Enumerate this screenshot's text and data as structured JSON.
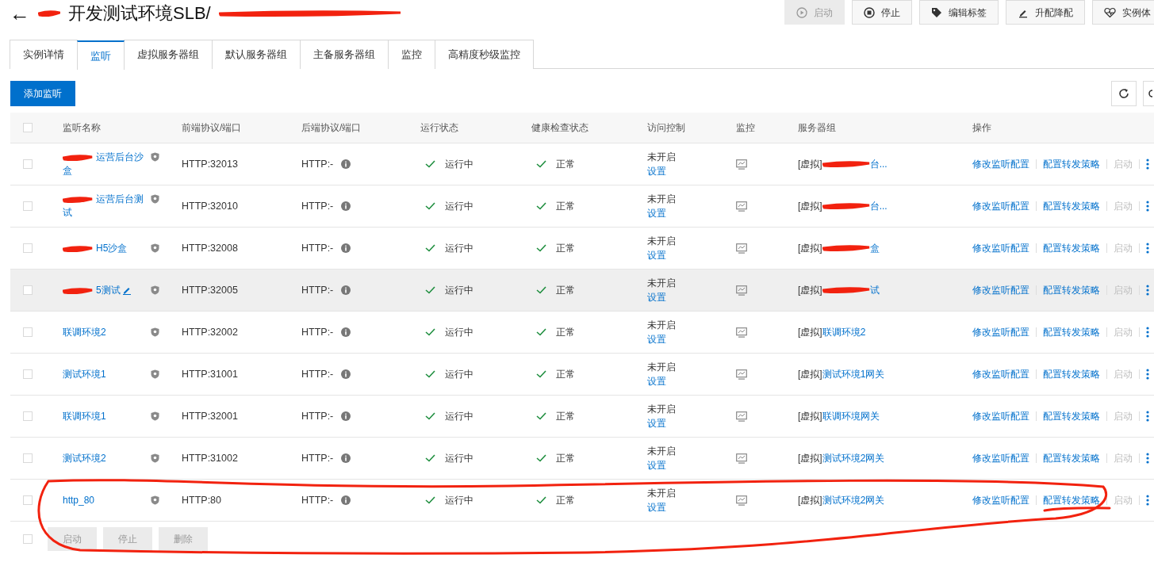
{
  "header": {
    "back": "←",
    "title": "开发测试环境SLB/",
    "title_redacted": true
  },
  "toolbar": [
    {
      "label": "启动",
      "disabled": true
    },
    {
      "label": "停止",
      "disabled": false
    },
    {
      "label": "编辑标签",
      "disabled": false
    },
    {
      "label": "升配降配",
      "disabled": false
    },
    {
      "label": "实例体",
      "disabled": false
    }
  ],
  "tabs": [
    {
      "label": "实例详情",
      "selected": false
    },
    {
      "label": "监听",
      "selected": true
    },
    {
      "label": "虚拟服务器组",
      "selected": false
    },
    {
      "label": "默认服务器组",
      "selected": false
    },
    {
      "label": "主备服务器组",
      "selected": false
    },
    {
      "label": "监控",
      "selected": false
    },
    {
      "label": "高精度秒级监控",
      "selected": false
    }
  ],
  "add_button": "添加监听",
  "table": {
    "all_checked": false,
    "columns": [
      "监听名称",
      "前端协议/端口",
      "后端协议/端口",
      "运行状态",
      "健康检查状态",
      "访问控制",
      "监控",
      "服务器组",
      "操作"
    ],
    "rows": [
      {
        "name": "运营后台沙盒",
        "name_redacted": true,
        "editable": false,
        "hovered": false,
        "circled": false,
        "frontend": "HTTP:32013",
        "backend": "HTTP:-",
        "status": "运行中",
        "health": "正常",
        "access": "未开启",
        "access_link": "设置",
        "group_prefix": "[虚拟]",
        "group": "台...",
        "group_redacted": true,
        "checked": false,
        "ops": [
          {
            "label": "修改监听配置",
            "disabled": false,
            "underlined": false
          },
          {
            "label": "配置转发策略",
            "disabled": false,
            "underlined": false
          },
          {
            "label": "启动",
            "disabled": true,
            "underlined": false
          }
        ]
      },
      {
        "name": "运营后台测试",
        "name_redacted": true,
        "editable": false,
        "hovered": false,
        "circled": false,
        "frontend": "HTTP:32010",
        "backend": "HTTP:-",
        "status": "运行中",
        "health": "正常",
        "access": "未开启",
        "access_link": "设置",
        "group_prefix": "[虚拟]",
        "group": "台...",
        "group_redacted": true,
        "checked": false,
        "ops": [
          {
            "label": "修改监听配置",
            "disabled": false,
            "underlined": false
          },
          {
            "label": "配置转发策略",
            "disabled": false,
            "underlined": false
          },
          {
            "label": "启动",
            "disabled": true,
            "underlined": false
          }
        ]
      },
      {
        "name": "H5沙盒",
        "name_redacted": true,
        "editable": false,
        "hovered": false,
        "circled": false,
        "frontend": "HTTP:32008",
        "backend": "HTTP:-",
        "status": "运行中",
        "health": "正常",
        "access": "未开启",
        "access_link": "设置",
        "group_prefix": "[虚拟]",
        "group": "盒",
        "group_redacted": true,
        "checked": false,
        "ops": [
          {
            "label": "修改监听配置",
            "disabled": false,
            "underlined": false
          },
          {
            "label": "配置转发策略",
            "disabled": false,
            "underlined": false
          },
          {
            "label": "启动",
            "disabled": true,
            "underlined": false
          }
        ]
      },
      {
        "name": "5测试",
        "name_redacted": true,
        "editable": true,
        "hovered": true,
        "circled": false,
        "frontend": "HTTP:32005",
        "backend": "HTTP:-",
        "status": "运行中",
        "health": "正常",
        "access": "未开启",
        "access_link": "设置",
        "group_prefix": "[虚拟]",
        "group": "试",
        "group_redacted": true,
        "checked": false,
        "ops": [
          {
            "label": "修改监听配置",
            "disabled": false,
            "underlined": false
          },
          {
            "label": "配置转发策略",
            "disabled": false,
            "underlined": false
          },
          {
            "label": "启动",
            "disabled": true,
            "underlined": false
          }
        ]
      },
      {
        "name": "联调环境2",
        "name_redacted": false,
        "editable": false,
        "hovered": false,
        "circled": false,
        "frontend": "HTTP:32002",
        "backend": "HTTP:-",
        "status": "运行中",
        "health": "正常",
        "access": "未开启",
        "access_link": "设置",
        "group_prefix": "[虚拟]",
        "group": "联调环境2",
        "group_redacted": false,
        "checked": false,
        "ops": [
          {
            "label": "修改监听配置",
            "disabled": false,
            "underlined": false
          },
          {
            "label": "配置转发策略",
            "disabled": false,
            "underlined": false
          },
          {
            "label": "启动",
            "disabled": true,
            "underlined": false
          }
        ]
      },
      {
        "name": "测试环境1",
        "name_redacted": false,
        "editable": false,
        "hovered": false,
        "circled": false,
        "frontend": "HTTP:31001",
        "backend": "HTTP:-",
        "status": "运行中",
        "health": "正常",
        "access": "未开启",
        "access_link": "设置",
        "group_prefix": "[虚拟]",
        "group": "测试环境1网关",
        "group_redacted": false,
        "checked": false,
        "ops": [
          {
            "label": "修改监听配置",
            "disabled": false,
            "underlined": false
          },
          {
            "label": "配置转发策略",
            "disabled": false,
            "underlined": false
          },
          {
            "label": "启动",
            "disabled": true,
            "underlined": false
          }
        ]
      },
      {
        "name": "联调环境1",
        "name_redacted": false,
        "editable": false,
        "hovered": false,
        "circled": false,
        "frontend": "HTTP:32001",
        "backend": "HTTP:-",
        "status": "运行中",
        "health": "正常",
        "access": "未开启",
        "access_link": "设置",
        "group_prefix": "[虚拟]",
        "group": "联调环境网关",
        "group_redacted": false,
        "checked": false,
        "ops": [
          {
            "label": "修改监听配置",
            "disabled": false,
            "underlined": false
          },
          {
            "label": "配置转发策略",
            "disabled": false,
            "underlined": false
          },
          {
            "label": "启动",
            "disabled": true,
            "underlined": false
          }
        ]
      },
      {
        "name": "测试环境2",
        "name_redacted": false,
        "editable": false,
        "hovered": false,
        "circled": false,
        "frontend": "HTTP:31002",
        "backend": "HTTP:-",
        "status": "运行中",
        "health": "正常",
        "access": "未开启",
        "access_link": "设置",
        "group_prefix": "[虚拟]",
        "group": "测试环境2网关",
        "group_redacted": false,
        "checked": false,
        "ops": [
          {
            "label": "修改监听配置",
            "disabled": false,
            "underlined": false
          },
          {
            "label": "配置转发策略",
            "disabled": false,
            "underlined": false
          },
          {
            "label": "启动",
            "disabled": true,
            "underlined": false
          }
        ]
      },
      {
        "name": "http_80",
        "name_redacted": false,
        "editable": false,
        "hovered": false,
        "circled": true,
        "frontend": "HTTP:80",
        "backend": "HTTP:-",
        "status": "运行中",
        "health": "正常",
        "access": "未开启",
        "access_link": "设置",
        "group_prefix": "[虚拟]",
        "group": "测试环境2网关",
        "group_redacted": false,
        "checked": false,
        "ops": [
          {
            "label": "修改监听配置",
            "disabled": false,
            "underlined": false
          },
          {
            "label": "配置转发策略",
            "disabled": false,
            "underlined": true
          },
          {
            "label": "启动",
            "disabled": true,
            "underlined": false
          }
        ]
      }
    ]
  },
  "batch": {
    "checked": false,
    "buttons": [
      {
        "label": "启动",
        "disabled": true
      },
      {
        "label": "停止",
        "disabled": true
      },
      {
        "label": "删除",
        "disabled": true
      }
    ]
  }
}
